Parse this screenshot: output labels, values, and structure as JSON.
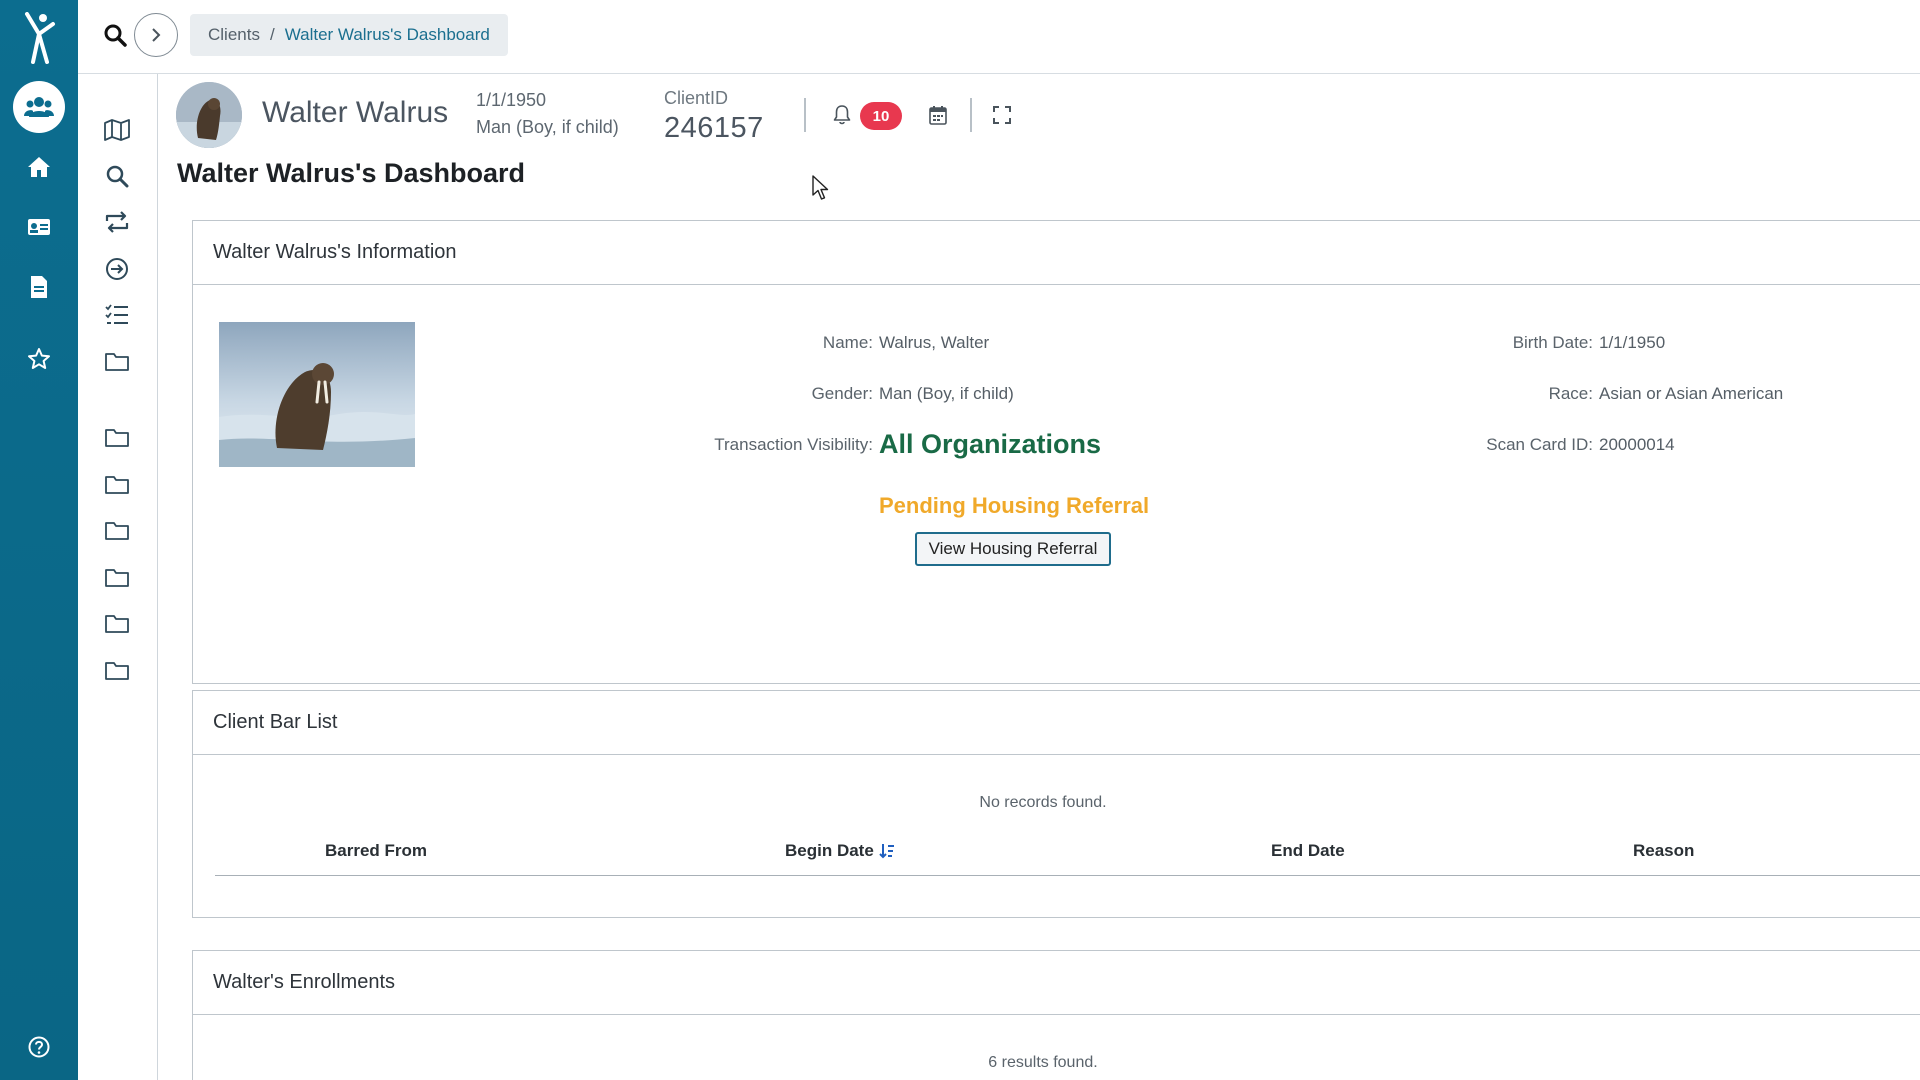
{
  "breadcrumb": {
    "root": "Clients",
    "separator": "/",
    "current": "Walter Walrus's Dashboard"
  },
  "client": {
    "name": "Walter Walrus",
    "dob": "1/1/1950",
    "gender": "Man (Boy, if child)",
    "client_id_label": "ClientID",
    "client_id": "246157",
    "notification_count": "10"
  },
  "page_title": "Walter Walrus's Dashboard",
  "info_panel": {
    "title": "Walter Walrus's Information",
    "name_label": "Name:",
    "name_value": "Walrus, Walter",
    "gender_label": "Gender:",
    "gender_value": "Man (Boy, if child)",
    "visibility_label": "Transaction Visibility:",
    "visibility_value": "All Organizations",
    "birth_label": "Birth Date:",
    "birth_value": "1/1/1950",
    "race_label": "Race:",
    "race_value": "Asian or Asian American",
    "scan_label": "Scan Card ID:",
    "scan_value": "20000014",
    "pending_text": "Pending Housing Referral",
    "view_button": "View Housing Referral"
  },
  "bar_list": {
    "title": "Client Bar List",
    "empty_text": "No records found.",
    "columns": [
      "Barred From",
      "Begin Date",
      "End Date",
      "Reason"
    ]
  },
  "enrollments": {
    "title": "Walter's Enrollments",
    "results_text": "6 results found."
  },
  "colors": {
    "rail": "#0c6d8f",
    "accent_green": "#196a46",
    "pending_orange": "#f0a92a",
    "badge_red": "#e8384f",
    "link_blue": "#1b6f8f"
  },
  "icons": {
    "rail": [
      "app-logo-icon",
      "clients-icon",
      "home-icon",
      "id-card-icon",
      "document-icon",
      "star-icon",
      "help-icon"
    ],
    "sub": [
      "map-icon",
      "search-icon",
      "transfer-icon",
      "arrow-circle-icon",
      "checklist-icon",
      "folder-icon"
    ]
  }
}
